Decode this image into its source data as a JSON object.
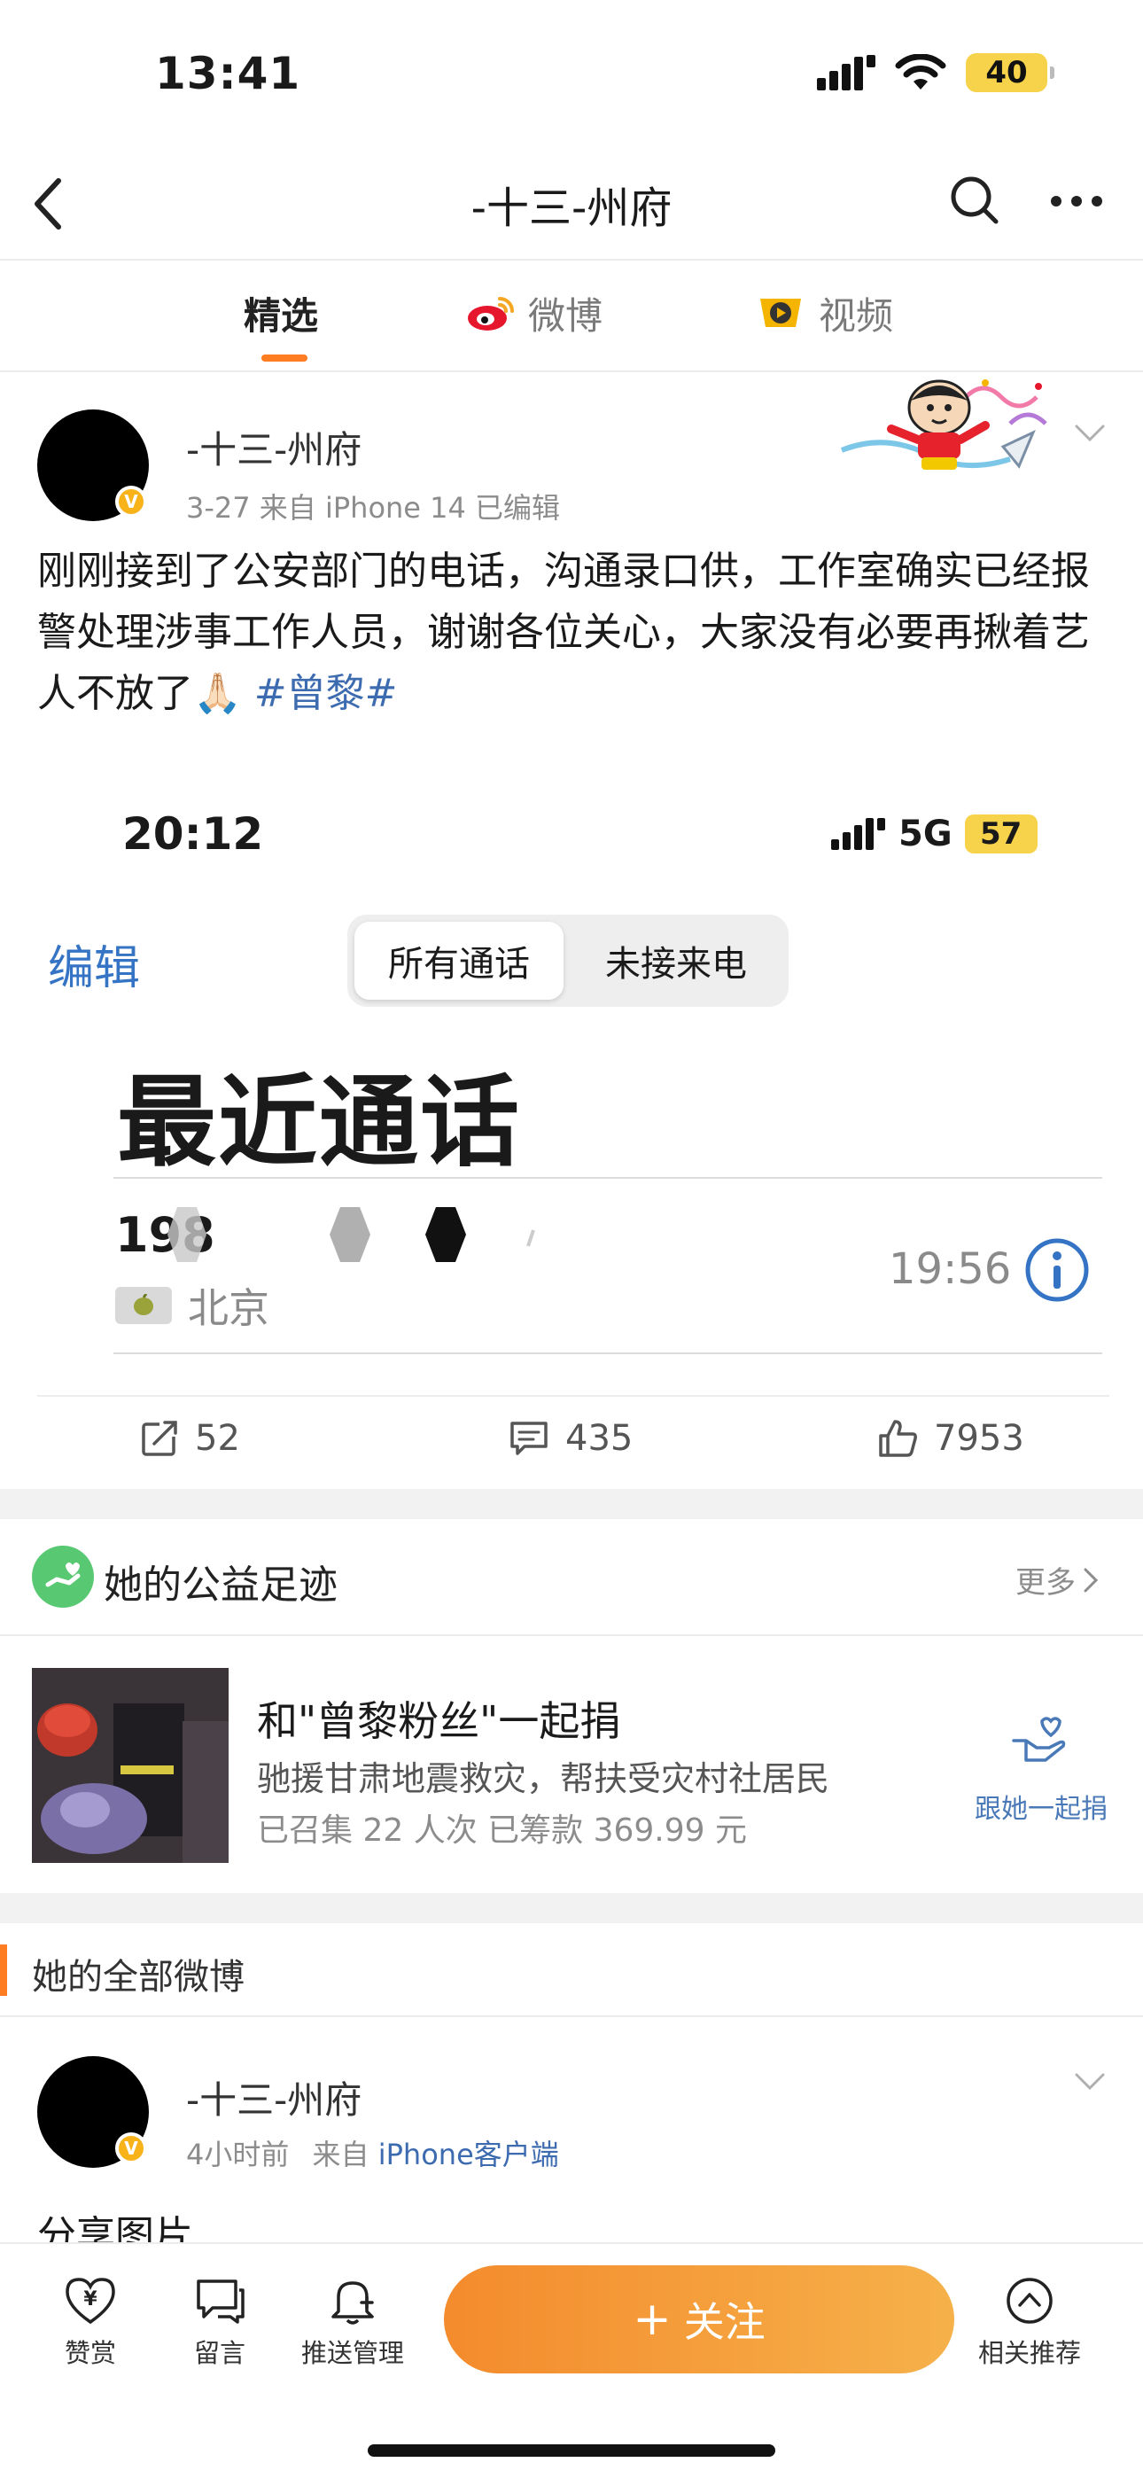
{
  "status_bar": {
    "time": "13:41",
    "battery": "40"
  },
  "nav": {
    "title": "-十三-州府"
  },
  "tabs": [
    {
      "label": "精选"
    },
    {
      "label": "微博"
    },
    {
      "label": "视频"
    }
  ],
  "post": {
    "author": "-十三-州府",
    "meta": "3-27  来自 iPhone 14  已编辑",
    "text": "刚刚接到了公安部门的电话，沟通录口供，工作室确实已经报警处理涉事工作人员，谢谢各位关心，大家没有必要再揪着艺人不放了🙏🏻 ",
    "hashtag": "#曾黎#",
    "embedded": {
      "time": "20:12",
      "network": "5G",
      "battery": "57",
      "edit": "编辑",
      "segment_all": "所有通话",
      "segment_missed": "未接来电",
      "heading": "最近通话",
      "call_number": "198",
      "call_location": "北京",
      "call_time": "19:56"
    },
    "actions": {
      "reposts": "52",
      "comments": "435",
      "likes": "7953"
    }
  },
  "charity": {
    "title": "她的公益足迹",
    "more": "更多",
    "project_name": "和\"曾黎粉丝\"一起捐",
    "project_desc": "驰援甘肃地震救灾，帮扶受灾村社居民",
    "project_stats": "已召集 22 人次 已筹款 369.99 元",
    "join_label": "跟她一起捐"
  },
  "all_posts": {
    "title": "她的全部微博"
  },
  "post2": {
    "author": "-十三-州府",
    "time": "4小时前",
    "source_prefix": "来自",
    "source": "iPhone客户端",
    "text": "分享图片"
  },
  "bottom_bar": {
    "reward": "赞赏",
    "message": "留言",
    "push": "推送管理",
    "follow": "关注",
    "follow_plus": "+",
    "related": "相关推荐"
  },
  "colors": {
    "accent": "#ff7d22",
    "link": "#3d6bb0",
    "verified": "#f8b21a"
  }
}
